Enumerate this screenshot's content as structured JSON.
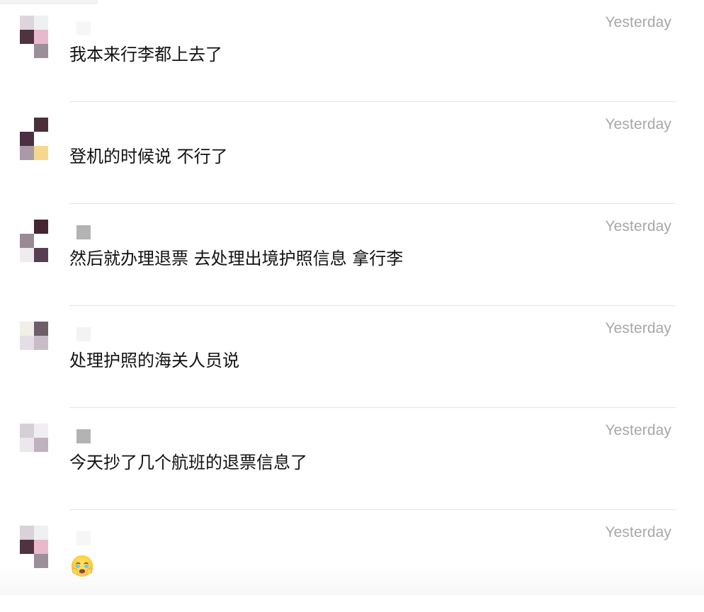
{
  "messages": [
    {
      "timestamp": "Yesterday",
      "text": "我本来行李都上去了",
      "sender_color": "#f6f6f6",
      "avatar_tiles": [
        "#dcd6dc",
        "#eef1f1",
        "#4f3340",
        "#e8b9cb",
        "#ffffff",
        "#9c8f9a"
      ]
    },
    {
      "timestamp": "Yesterday",
      "text": "登机的时候说 不行了",
      "sender_color": "#ffffff",
      "avatar_tiles": [
        "#ffffff",
        "#4a2f39",
        "#4a3042",
        "#ffffff",
        "#aa9aa8",
        "#f5d88d"
      ]
    },
    {
      "timestamp": "Yesterday",
      "text": "然后就办理退票 去处理出境护照信息 拿行李",
      "sender_color": "#b3b3b3",
      "avatar_tiles": [
        "#ffffff",
        "#452633",
        "#9a8a95",
        "#ffffff",
        "#f0ecee",
        "#573f52"
      ]
    },
    {
      "timestamp": "Yesterday",
      "text": "处理护照的海关人员说",
      "sender_color": "#f3f3f3",
      "avatar_tiles": [
        "#f1efe8",
        "#6d5f69",
        "#e3dfe4",
        "#c8bdc7",
        "#ffffff",
        "#ffffff"
      ]
    },
    {
      "timestamp": "Yesterday",
      "text": "今天抄了几个航班的退票信息了",
      "sender_color": "#b3b3b3",
      "avatar_tiles": [
        "#d6d0d6",
        "#f0eef0",
        "#ebe7ec",
        "#bfb2bd",
        "#ffffff",
        "#ffffff"
      ]
    },
    {
      "timestamp": "Yesterday",
      "text": "",
      "emoji": "face-holding-back-tears",
      "sender_color": "#f6f6f6",
      "avatar_tiles": [
        "#d9d3d9",
        "#eef1f1",
        "#4f3340",
        "#e8b9cb",
        "#ffffff",
        "#9c8f9a"
      ]
    }
  ]
}
